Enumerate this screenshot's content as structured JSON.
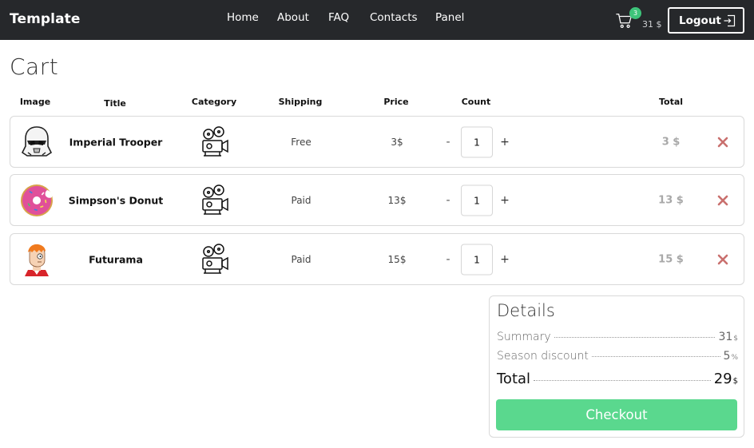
{
  "navbar": {
    "brand": "Template",
    "links": [
      "Home",
      "About",
      "FAQ",
      "Contacts",
      "Panel"
    ],
    "cart_count": "3",
    "cart_amount": "31 $",
    "logout_label": "Logout"
  },
  "page_title": "Cart",
  "table": {
    "headers": [
      "Image",
      "Title",
      "Category",
      "Shipping",
      "Price",
      "Count",
      "Total"
    ],
    "rows": [
      {
        "title": "Imperial Trooper",
        "shipping": "Free",
        "price": "3$",
        "minus": "-",
        "count": "1",
        "plus": "+",
        "total": "3 $",
        "image": "stormtrooper-helmet"
      },
      {
        "title": "Simpson's Donut",
        "shipping": "Paid",
        "price": "13$",
        "minus": "-",
        "count": "1",
        "plus": "+",
        "total": "13 $",
        "image": "pink-donut"
      },
      {
        "title": "Futurama",
        "shipping": "Paid",
        "price": "15$",
        "minus": "-",
        "count": "1",
        "plus": "+",
        "total": "15 $",
        "image": "fry-character"
      }
    ],
    "category_icon": "film-projector-icon",
    "remove_icon": "close-x-icon"
  },
  "details": {
    "title": "Details",
    "summary_label": "Summary",
    "summary_value": "31",
    "summary_unit": "$",
    "discount_label": "Season discount",
    "discount_value": "5",
    "discount_unit": "%",
    "total_label": "Total",
    "total_value": "29",
    "total_unit": "$",
    "checkout_label": "Checkout"
  },
  "colors": {
    "navbar": "#26282b",
    "badge": "#3ec47a",
    "checkout": "#5ad88e",
    "remove": "#c9706e"
  }
}
